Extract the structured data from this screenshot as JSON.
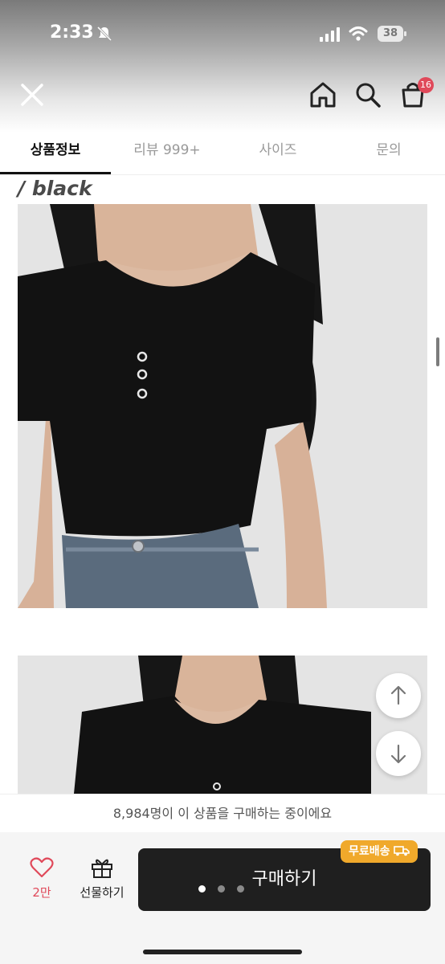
{
  "status_bar": {
    "time": "2:33",
    "battery": "38"
  },
  "header": {
    "cart_count": "16"
  },
  "tabs": [
    {
      "label": "상품정보"
    },
    {
      "label": "리뷰 999+"
    },
    {
      "label": "사이즈"
    },
    {
      "label": "문의"
    }
  ],
  "product": {
    "color_label": "/ black"
  },
  "banner": {
    "text": "8,984명이 이 상품을 구매하는 중이에요"
  },
  "bottom": {
    "like_count": "2만",
    "gift_label": "선물하기",
    "buy_label": "구매하기",
    "free_shipping": "무료배송"
  },
  "colors": {
    "accent": "#e0495a",
    "badge": "#f0a92b",
    "buy_button": "#1f1f1f"
  }
}
